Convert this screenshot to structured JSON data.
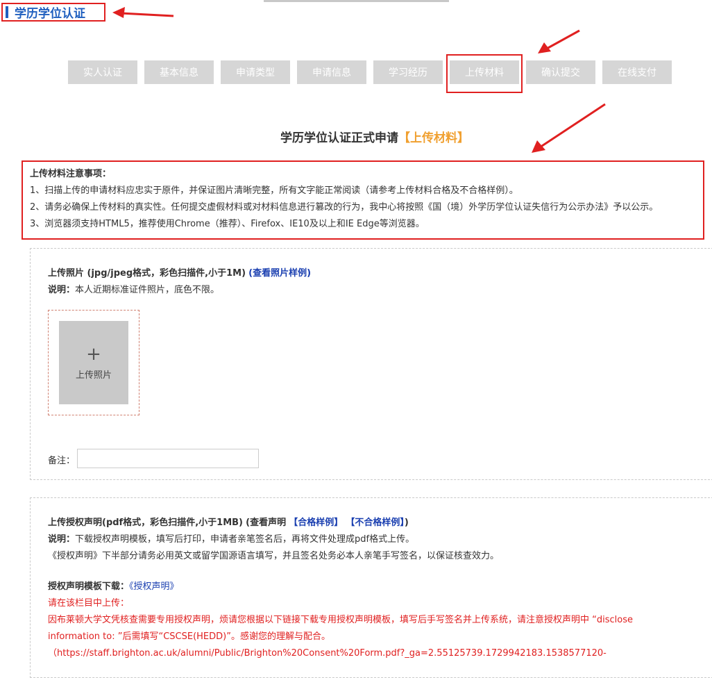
{
  "page": {
    "heading": "学历学位认证"
  },
  "steps": [
    {
      "label": "实人认证"
    },
    {
      "label": "基本信息"
    },
    {
      "label": "申请类型"
    },
    {
      "label": "申请信息"
    },
    {
      "label": "学习经历"
    },
    {
      "label": "上传材料"
    },
    {
      "label": "确认提交"
    },
    {
      "label": "在线支付"
    }
  ],
  "form": {
    "title": "学历学位认证正式申请",
    "title_tag": "【上传材料】"
  },
  "notice": {
    "title": "上传材料注意事项：",
    "items": [
      "1、扫描上传的申请材料应忠实于原件，并保证图片清晰完整，所有文字能正常阅读（请参考上传材料合格及不合格样例）。",
      "2、请务必确保上传材料的真实性。任何提交虚假材料或对材料信息进行篡改的行为，我中心将按照《国（境）外学历学位认证失信行为公示办法》予以公示。",
      "3、浏览器须支持HTML5，推荐使用Chrome（推荐）、Firefox、IE10及以上和IE Edge等浏览器。"
    ]
  },
  "photo": {
    "title": "上传照片 (jpg/jpeg格式，彩色扫描件,小于1M)",
    "sample_link": "(查看照片样例)",
    "desc_label": "说明：",
    "desc": "本人近期标准证件照片，底色不限。",
    "plus": "+",
    "upload_label": "上传照片",
    "remark_label": "备注：",
    "remark_value": ""
  },
  "auth": {
    "title": "上传授权声明(pdf格式，彩色扫描件,小于1MB)",
    "view_text": "(查看声明",
    "ok_link": "【合格样例】",
    "bad_link": "【不合格样例】",
    "view_close": ")",
    "desc_label": "说明：",
    "desc1": "下载授权声明模板，填写后打印，申请者亲笔签名后，再将文件处理成pdf格式上传。",
    "desc2": "《授权声明》下半部分请务必用英文或留学国源语言填写，并且签名处务必本人亲笔手写签名，以保证核查效力。",
    "template_label": "授权声明模板下载：",
    "template_link": "《授权声明》",
    "red1": "请在该栏目中上传：",
    "red2": "因布莱顿大学文凭核查需要专用授权声明，烦请您根据以下链接下载专用授权声明模板，填写后手写签名并上传系统，请注意授权声明中 “disclose",
    "red3": "information to: ”后需填写“CSCSE(HEDD)”。感谢您的理解与配合。",
    "red4": "（https://staff.brighton.ac.uk/alumni/Public/Brighton%20Consent%20Form.pdf?_ga=2.55125739.1729942183.1538577120-"
  }
}
